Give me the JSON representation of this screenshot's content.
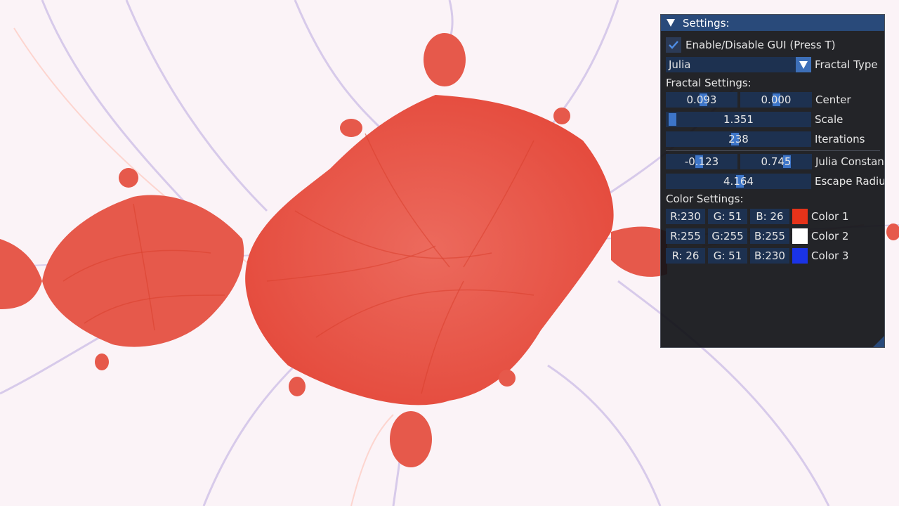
{
  "panel": {
    "title": "Settings:",
    "gui_toggle": {
      "label": "Enable/Disable GUI (Press T)",
      "checked": true
    },
    "fractal_type": {
      "value": "Julia",
      "label": "Fractal Type"
    },
    "fractal_settings_header": "Fractal Settings:",
    "center": {
      "x": "0.093",
      "y": "0.000",
      "label": "Center"
    },
    "scale": {
      "value": "1.351",
      "label": "Scale"
    },
    "iterations": {
      "value": "238",
      "label": "Iterations"
    },
    "julia_constant": {
      "re": "-0.123",
      "im": "0.745",
      "label": "Julia Constant"
    },
    "escape_radius": {
      "value": "4.164",
      "label": "Escape Radius"
    },
    "color_settings_header": "Color Settings:",
    "colors": [
      {
        "r": "R:230",
        "g": "G: 51",
        "b": "B: 26",
        "label": "Color 1",
        "hex": "#e6331a"
      },
      {
        "r": "R:255",
        "g": "G:255",
        "b": "B:255",
        "label": "Color 2",
        "hex": "#ffffff"
      },
      {
        "r": "R: 26",
        "g": "G: 51",
        "b": "B:230",
        "label": "Color 3",
        "hex": "#1a33e6"
      }
    ]
  },
  "theme": {
    "fractal_fill": "#e9574a",
    "fractal_edge": "#d8452f",
    "background": "#fbf3f6",
    "accent": "#3d75c8"
  }
}
